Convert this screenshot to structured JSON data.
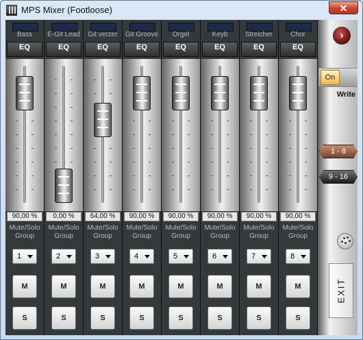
{
  "window": {
    "title": "MPS Mixer (Footloose)",
    "close_label": "✕"
  },
  "channels": [
    {
      "name": "Bass",
      "eq": "EQ",
      "value": "90,00 %",
      "level": 0.9,
      "msg": "Mute/Solo\nGroup",
      "group": "1",
      "mute": "M",
      "solo": "S"
    },
    {
      "name": "E-Git Lead",
      "eq": "EQ",
      "value": "0,00 %",
      "level": 0.0,
      "msg": "Mute/Solo\nGroup",
      "group": "2",
      "mute": "M",
      "solo": "S"
    },
    {
      "name": "Git verzer",
      "eq": "EQ",
      "value": "64,00 %",
      "level": 0.64,
      "msg": "Mute/Solo\nGroup",
      "group": "3",
      "mute": "M",
      "solo": "S"
    },
    {
      "name": "Git Groove",
      "eq": "EQ",
      "value": "90,00 %",
      "level": 0.9,
      "msg": "Mute/Solo\nGroup",
      "group": "4",
      "mute": "M",
      "solo": "S"
    },
    {
      "name": "Orgel",
      "eq": "EQ",
      "value": "90,00 %",
      "level": 0.9,
      "msg": "Mute/Solo\nGroup",
      "group": "5",
      "mute": "M",
      "solo": "S"
    },
    {
      "name": "Keyb",
      "eq": "EQ",
      "value": "90,00 %",
      "level": 0.9,
      "msg": "Mute/Solo\nGroup",
      "group": "6",
      "mute": "M",
      "solo": "S"
    },
    {
      "name": "Streicher",
      "eq": "EQ",
      "value": "90,00 %",
      "level": 0.9,
      "msg": "Mute/Solo\nGroup",
      "group": "7",
      "mute": "M",
      "solo": "S"
    },
    {
      "name": "Chor",
      "eq": "EQ",
      "value": "90,00 %",
      "level": 0.9,
      "msg": "Mute/Solo\nGroup",
      "group": "8",
      "mute": "M",
      "solo": "S"
    }
  ],
  "side": {
    "next_label": "›",
    "toggle_on_label": "On",
    "write_label": "Write",
    "bank1_label": "1 - 8",
    "bank2_label": "9 - 16",
    "exit_label": "EXIT"
  },
  "colors": {
    "bank_active": "#a0634a",
    "toggle_on": "#f2b648",
    "close": "#c7442c"
  },
  "icons": {
    "app": "mixer-icon",
    "next": "chevron-right-icon",
    "midi": "midi-connector-icon"
  }
}
